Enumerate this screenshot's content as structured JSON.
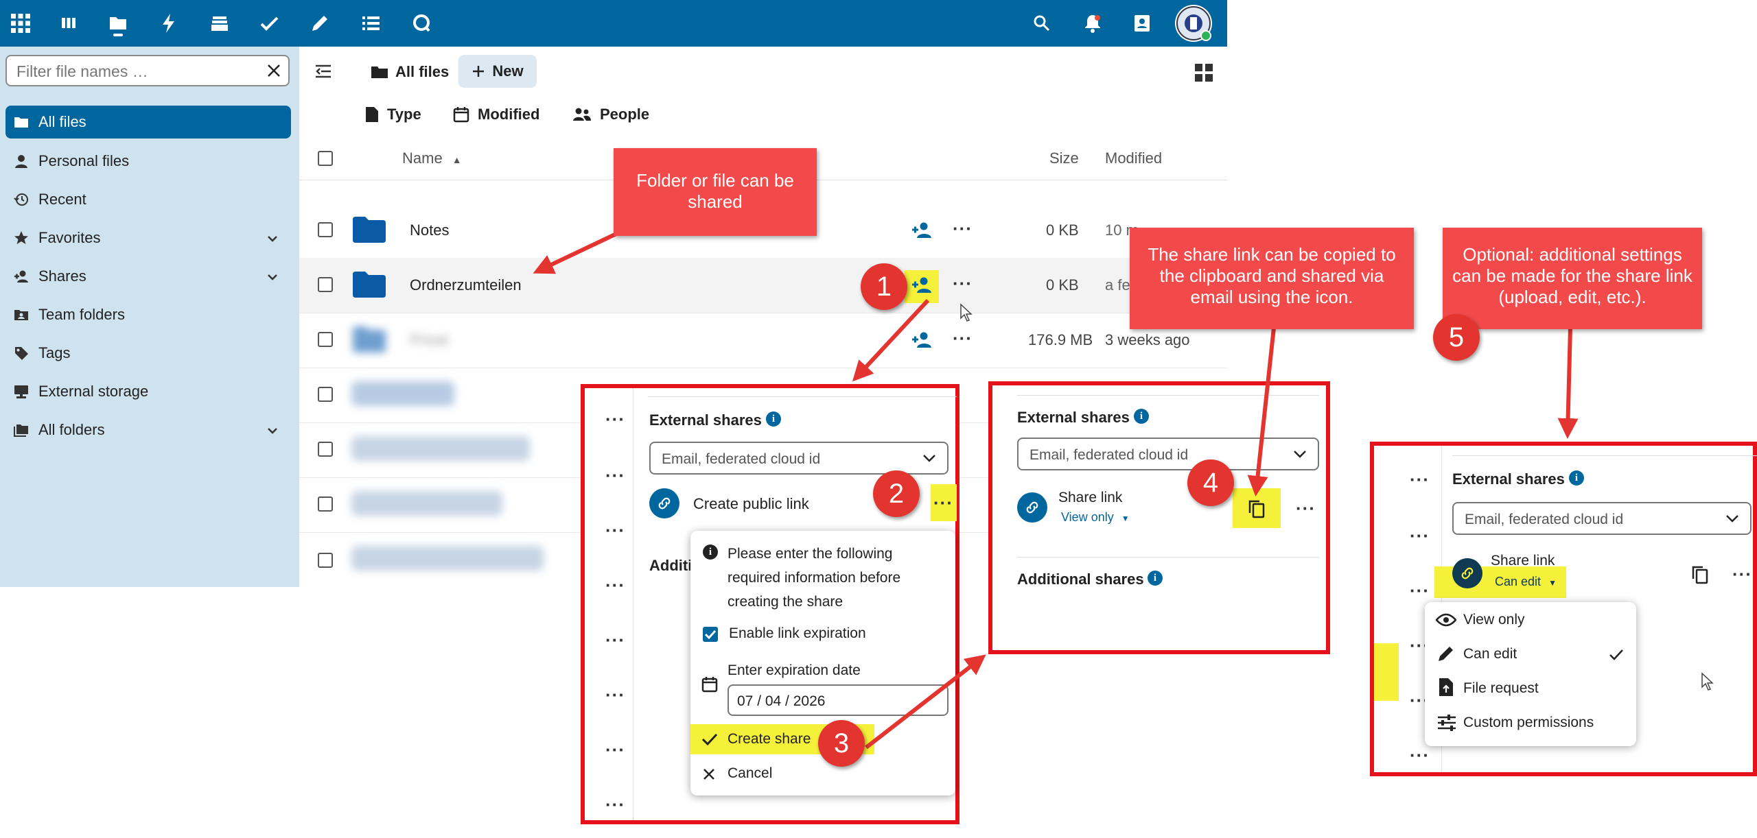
{
  "topbar": {
    "apps": [
      "apps-icon",
      "deck-icon",
      "files-icon",
      "activity-icon",
      "stack-icon",
      "tasks-icon",
      "notes-icon",
      "list-icon",
      "talk-icon"
    ],
    "right": [
      "search-icon",
      "notifications-icon",
      "contacts-icon",
      "avatar"
    ]
  },
  "sidebar": {
    "filter_placeholder": "Filter file names …",
    "items": [
      {
        "label": "All files",
        "icon": "folder-icon",
        "active": true
      },
      {
        "label": "Personal files",
        "icon": "person-icon"
      },
      {
        "label": "Recent",
        "icon": "history-icon"
      },
      {
        "label": "Favorites",
        "icon": "star-icon",
        "chevron": true
      },
      {
        "label": "Shares",
        "icon": "share-icon",
        "chevron": true
      },
      {
        "label": "Team folders",
        "icon": "group-icon"
      },
      {
        "label": "Tags",
        "icon": "tag-icon"
      },
      {
        "label": "External storage",
        "icon": "storage-icon"
      },
      {
        "label": "All folders",
        "icon": "folders-icon",
        "chevron": true
      }
    ]
  },
  "main": {
    "breadcrumb": "All files",
    "new_label": "New",
    "filters": [
      "Type",
      "Modified",
      "People"
    ],
    "columns": {
      "name": "Name",
      "size": "Size",
      "modified": "Modified"
    },
    "rows": [
      {
        "name": "Notes",
        "size": "0 KB",
        "modified": "10 m"
      },
      {
        "name": "Ordnerzumteilen",
        "size": "0 KB",
        "modified": "a fe"
      },
      {
        "name": "Privat",
        "size": "176.9 MB",
        "modified": "3 weeks ago",
        "blurred": true
      }
    ]
  },
  "callouts": {
    "c1": "Folder or file can be shared",
    "c4": "The share link can be copied to the clipboard and shared via email using the icon.",
    "c5": "Optional: additional settings can be made for the share link (upload, edit, etc.)."
  },
  "steps": [
    "1",
    "2",
    "3",
    "4",
    "5"
  ],
  "panel1": {
    "external_title": "External shares",
    "field_placeholder": "Email, federated cloud id",
    "create_link": "Create public link",
    "additional_partial": "Additi",
    "menu": {
      "info": "Please enter the following required information before creating the share",
      "enable_expiration": "Enable link expiration",
      "expiration_label": "Enter expiration date",
      "date": "07 / 04 / 2026",
      "create": "Create share",
      "cancel": "Cancel"
    }
  },
  "panel2": {
    "external_title": "External shares",
    "field_placeholder": "Email, federated cloud id",
    "share_link": "Share link",
    "permission": "View only",
    "additional_title": "Additional shares"
  },
  "panel3": {
    "external_title": "External shares",
    "field_placeholder": "Email, federated cloud id",
    "share_link": "Share link",
    "permission": "Can edit",
    "menu": [
      "View only",
      "Can edit",
      "File request",
      "Custom permissions"
    ]
  },
  "colors": {
    "brand": "#00679e",
    "annotation": "#e3121b",
    "highlight": "#f5f03a"
  }
}
